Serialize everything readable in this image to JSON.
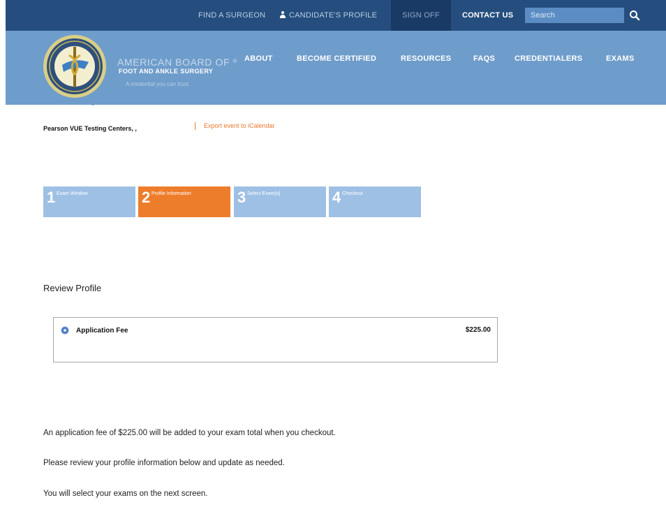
{
  "topbar": {
    "find_surgeon": "FIND A SURGEON",
    "candidate_profile": "CANDIDATE'S PROFILE",
    "sign_off": "SIGN OFF",
    "contact_us": "CONTACT US",
    "search_placeholder": "Search",
    "search_icon": "search-icon",
    "user_icon": "user-icon"
  },
  "header": {
    "org_line1": "AMERICAN BOARD OF",
    "org_line2": "FOOT AND ANKLE SURGERY",
    "tagline": "A credential you can trust.",
    "logo": "abfas-seal-logo",
    "nav": [
      {
        "label": "ABOUT"
      },
      {
        "label": "BECOME CERTIFIED"
      },
      {
        "label": "RESOURCES"
      },
      {
        "label": "FAQS"
      },
      {
        "label": "CREDENTIALERS"
      },
      {
        "label": "EXAMS"
      }
    ]
  },
  "event": {
    "name": "Pearson VUE Testing Centers, ,",
    "export_link": "Export event to iCalendar"
  },
  "steps": [
    {
      "num": "1",
      "label": "Exam Window",
      "active": false
    },
    {
      "num": "2",
      "label": "Profile Information",
      "active": true
    },
    {
      "num": "3",
      "label": "Select Exam(s)",
      "active": false
    },
    {
      "num": "4",
      "label": "Checkout",
      "active": false
    }
  ],
  "review": {
    "title": "Review Profile",
    "fee_label": "Application Fee",
    "fee_amount": "$225.00"
  },
  "messages": {
    "fee_note": "An application fee of $225.00 will be added to your exam total when you checkout.",
    "review_note": "Please review your profile information below and update as needed.",
    "next_note": "You will select your exams on the next screen."
  },
  "colors": {
    "topbar": "#254e7e",
    "header": "#6f9dcb",
    "accent_orange": "#ee7d2b",
    "step_inactive": "#9ec0e4"
  }
}
